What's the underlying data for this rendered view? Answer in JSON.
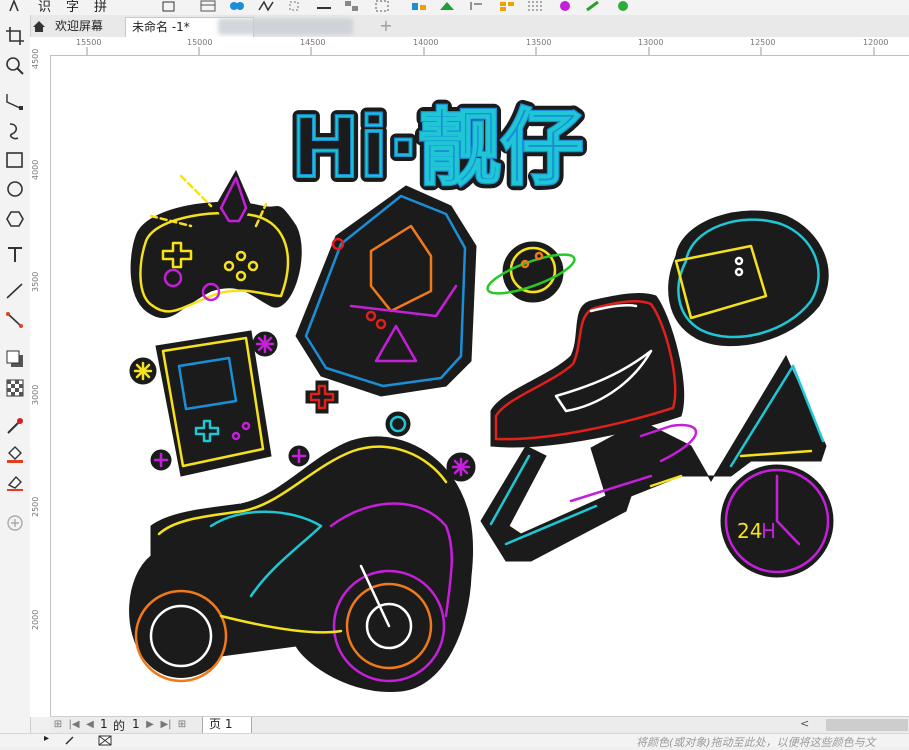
{
  "toolbar": {
    "text_items": [
      "识",
      "字",
      "拼"
    ]
  },
  "tabs": {
    "home_label": "欢迎屏幕",
    "doc_label": "未命名 -1*",
    "add_label": "+"
  },
  "ruler": {
    "h_labels": [
      "15500",
      "15000",
      "14500",
      "14000",
      "13500",
      "13000",
      "12500",
      "12000"
    ],
    "v_labels": [
      "4500",
      "4000",
      "3500",
      "3000",
      "2500",
      "2000"
    ]
  },
  "artwork": {
    "title_text": "Hi·靓仔",
    "badge_text": "24",
    "badge_suffix": "H",
    "colors": {
      "cyan": "#1fc7d4",
      "blue": "#1a8fd8",
      "yellow": "#f5e21c",
      "magenta": "#c41fd9",
      "orange": "#f07a1a",
      "red": "#e0201a",
      "green": "#28c828",
      "dark": "#1b1b1b",
      "white": "#ffffff"
    }
  },
  "pagebar": {
    "page_current": "1",
    "page_of": "的",
    "page_total": "1",
    "page_tab": "页 1"
  },
  "status": {
    "hint": "将颜色(或对象)拖动至此处，以便将这些颜色与文"
  }
}
